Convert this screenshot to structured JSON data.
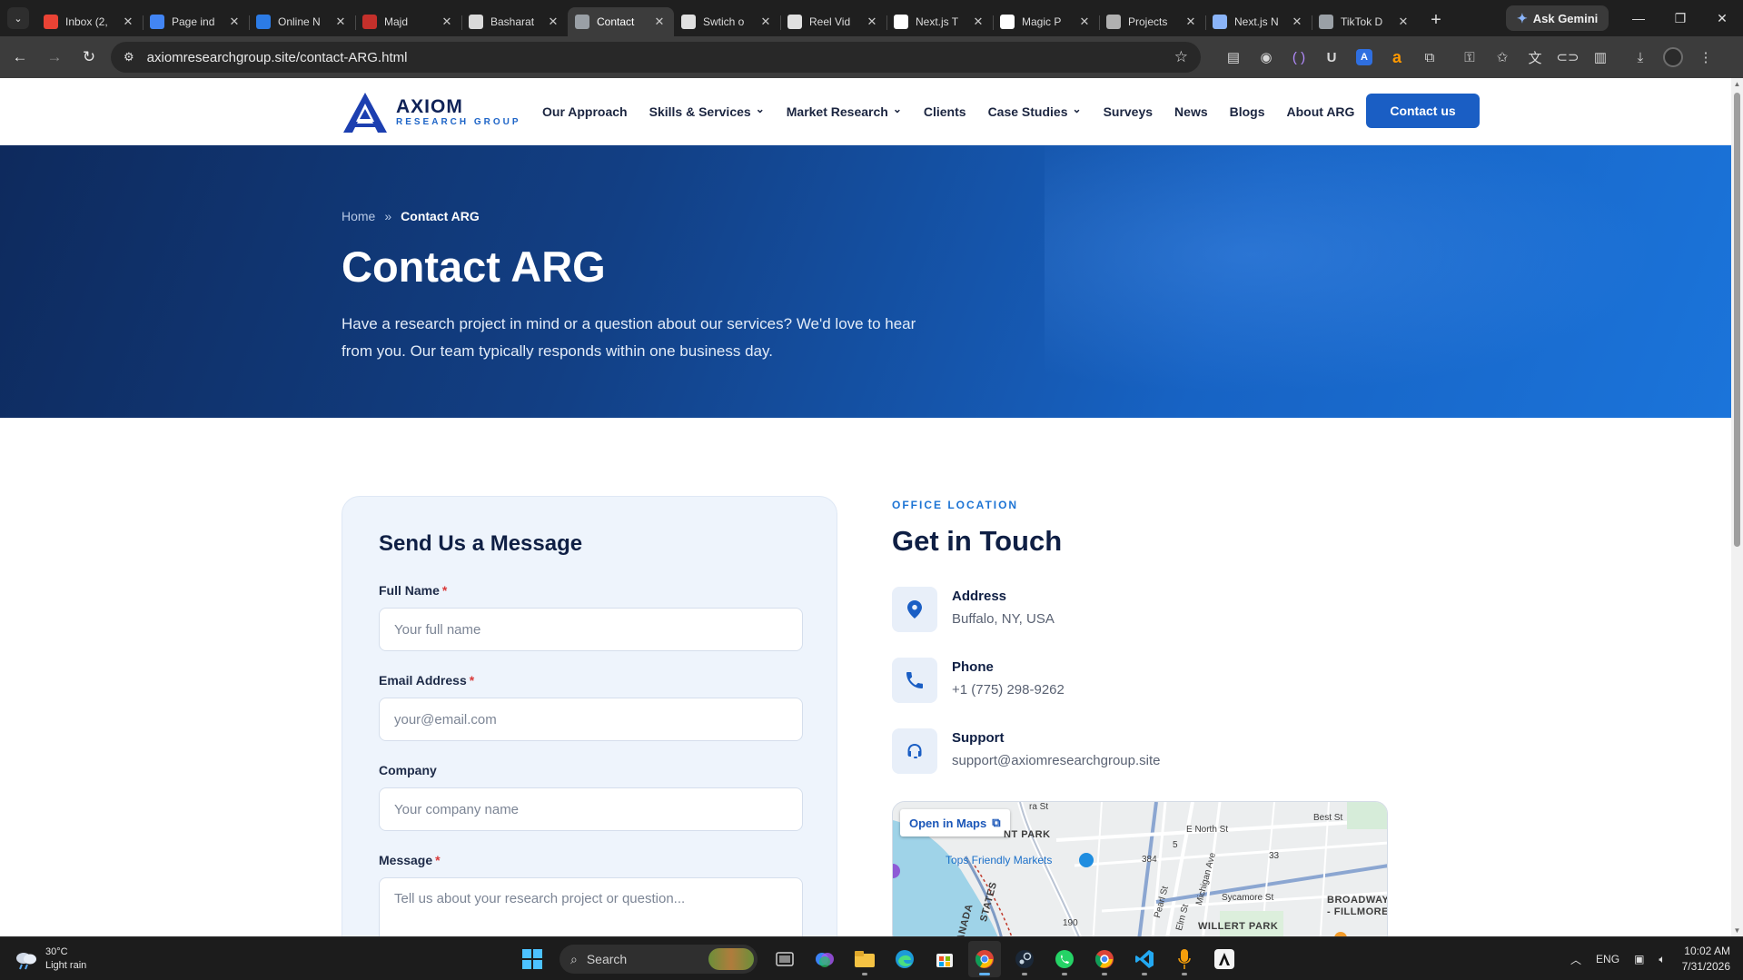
{
  "browser": {
    "tabs": [
      {
        "title": "Inbox (2,",
        "icon": "gmail-icon",
        "color": "#ea4335",
        "active": false
      },
      {
        "title": "Page ind",
        "icon": "search-console-icon",
        "color": "#4285f4",
        "active": false
      },
      {
        "title": "Online N",
        "icon": "play-icon",
        "color": "#2c7be5",
        "active": false
      },
      {
        "title": "Majd",
        "icon": "tiktok-logo-icon",
        "color": "#c4302b",
        "active": false
      },
      {
        "title": "Basharat",
        "icon": "document-icon",
        "color": "#d9d9d9",
        "active": false
      },
      {
        "title": "Contact",
        "icon": "globe-icon",
        "color": "#9aa0a6",
        "active": true
      },
      {
        "title": "Swtich o",
        "icon": "framer-icon",
        "color": "#e0e0e0",
        "active": false
      },
      {
        "title": "Reel Vid",
        "icon": "framer-icon",
        "color": "#e0e0e0",
        "active": false
      },
      {
        "title": "Next.js T",
        "icon": "triangle-icon",
        "color": "#ffffff",
        "active": false
      },
      {
        "title": "Magic P",
        "icon": "triangle-icon",
        "color": "#ffffff",
        "active": false
      },
      {
        "title": "Projects",
        "icon": "project-icon",
        "color": "#b0b0b0",
        "active": false
      },
      {
        "title": "Next.js N",
        "icon": "gemini-icon",
        "color": "#8ab4f8",
        "active": false
      },
      {
        "title": "TikTok D",
        "icon": "globe-icon",
        "color": "#9aa0a6",
        "active": false
      }
    ],
    "gemini_label": "Ask Gemini",
    "url": "axiomresearchgroup.site/contact-ARG.html"
  },
  "site": {
    "logo_name": "AXIOM",
    "logo_sub": "RESEARCH GROUP",
    "nav": [
      {
        "label": "Our Approach",
        "dropdown": false
      },
      {
        "label": "Skills & Services",
        "dropdown": true
      },
      {
        "label": "Market Research",
        "dropdown": true
      },
      {
        "label": "Clients",
        "dropdown": false
      },
      {
        "label": "Case Studies",
        "dropdown": true
      },
      {
        "label": "Surveys",
        "dropdown": false
      },
      {
        "label": "News",
        "dropdown": false
      },
      {
        "label": "Blogs",
        "dropdown": false
      },
      {
        "label": "About ARG",
        "dropdown": false
      }
    ],
    "cta_label": "Contact us",
    "brand_color": "#1a5ec4"
  },
  "hero": {
    "breadcrumb_home": "Home",
    "breadcrumb_sep": "»",
    "breadcrumb_current": "Contact ARG",
    "title": "Contact ARG",
    "lead": "Have a research project in mind or a question about our services? We'd love to hear from you. Our team typically responds within one business day."
  },
  "form": {
    "title": "Send Us a Message",
    "fields": [
      {
        "label": "Full Name",
        "required": true,
        "placeholder": "Your full name"
      },
      {
        "label": "Email Address",
        "required": true,
        "placeholder": "your@email.com"
      },
      {
        "label": "Company",
        "required": false,
        "placeholder": "Your company name"
      },
      {
        "label": "Message",
        "required": true,
        "placeholder": "Tell us about your research project or question..."
      }
    ],
    "required_mark": "*"
  },
  "contact": {
    "eyebrow": "OFFICE LOCATION",
    "title": "Get in Touch",
    "items": [
      {
        "label": "Address",
        "value": "Buffalo, NY, USA",
        "icon": "location-pin-icon"
      },
      {
        "label": "Phone",
        "value": "+1 (775) 298-9262",
        "icon": "phone-icon"
      },
      {
        "label": "Support",
        "value": "support@axiomresearchgroup.site",
        "icon": "headset-icon"
      }
    ]
  },
  "map": {
    "open_label": "Open in Maps",
    "labels": {
      "park_fragment": "NT PARK",
      "north_st": "E North St",
      "best_st": "Best St",
      "tops": "Tops Friendly Markets",
      "route_384": "384",
      "route_5": "5",
      "route_33": "33",
      "route_190": "190",
      "michigan": "Michigan Ave",
      "sycamore": "Sycamore St",
      "broadway": "BROADWAY",
      "fillmore": "- FILLMORE",
      "willert": "WILLERT PARK",
      "canada": "CANADA",
      "states": "STATES",
      "pearl": "Pearl St",
      "elm": "Elm St",
      "top_fragment": "ra St"
    }
  },
  "taskbar": {
    "temperature": "30°C",
    "weather": "Light rain",
    "search_label": "Search",
    "lang": "ENG",
    "time": "10:02 AM",
    "date": "7/31/2026"
  }
}
